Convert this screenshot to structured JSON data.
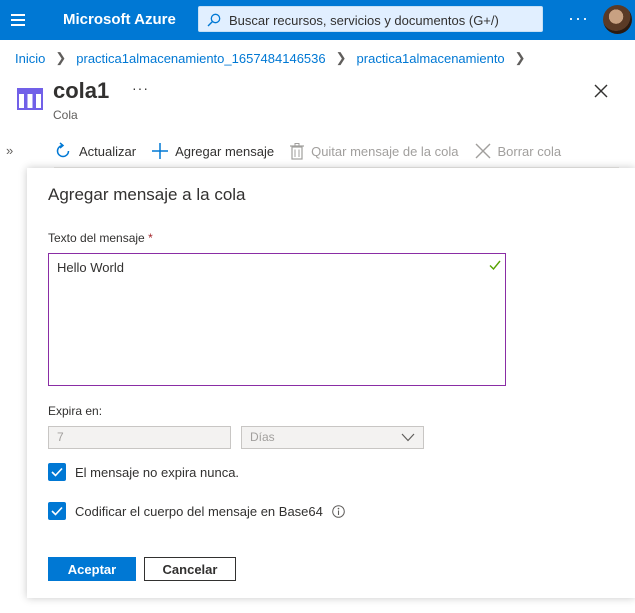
{
  "header": {
    "brand": "Microsoft Azure",
    "search_placeholder": "Buscar recursos, servicios y documentos (G+/)",
    "more": "···"
  },
  "breadcrumb": [
    "Inicio",
    "practica1almacenamiento_1657484146536",
    "practica1almacenamiento"
  ],
  "resource": {
    "title": "cola1",
    "more": "···",
    "subtitle": "Cola"
  },
  "toolbar": {
    "refresh": "Actualizar",
    "add_message": "Agregar mensaje",
    "dequeue_message": "Quitar mensaje de la cola",
    "clear_queue": "Borrar cola"
  },
  "panel": {
    "title": "Agregar mensaje a la cola",
    "message_label": "Texto del mensaje",
    "required_mark": "*",
    "message_value": "Hello World",
    "expires_label": "Expira en:",
    "expires_value": "7",
    "expires_unit": "Días",
    "never_expires_label": "El mensaje no expira nunca.",
    "never_expires_checked": true,
    "base64_label": "Codificar el cuerpo del mensaje en Base64",
    "base64_checked": true,
    "ok_button": "Aceptar",
    "cancel_button": "Cancelar"
  },
  "colors": {
    "azure_blue": "#0078d4",
    "textarea_border": "#8a2da5",
    "valid_check": "#57a300",
    "queue_icon": "#7160e8"
  },
  "icons": [
    "menu-icon",
    "search-icon",
    "avatar",
    "queue-icon",
    "close-icon",
    "refresh-icon",
    "plus-icon",
    "trash-icon",
    "x-icon",
    "checkmark-icon",
    "chevron-down-icon",
    "info-icon"
  ]
}
